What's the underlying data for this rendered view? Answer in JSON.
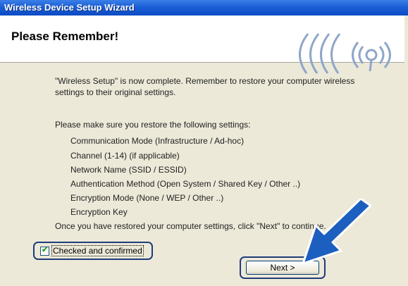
{
  "window": {
    "title": "Wireless Device Setup Wizard"
  },
  "header": {
    "title": "Please Remember!"
  },
  "content": {
    "intro_line1": "\"Wireless Setup\" is now complete. Remember to restore your computer wireless",
    "intro_line2": "settings to their original settings.",
    "list_intro": "Please make sure you restore the following settings:",
    "settings": [
      "Communication Mode (Infrastructure / Ad-hoc)",
      "Channel (1-14) (if applicable)",
      "Network Name (SSID / ESSID)",
      "Authentication Method (Open System / Shared Key / Other ..)",
      "Encryption Mode (None / WEP / Other ..)",
      "Encryption Key"
    ],
    "outro": "Once you have restored your computer settings, click \"Next\" to continue."
  },
  "controls": {
    "checkbox_label": "Checked and confirmed",
    "checkbox_checked": true,
    "next_label": "Next >"
  },
  "colors": {
    "title_bar": "#0b4bc4",
    "annotation_arrow": "#1c5fbf",
    "banner_blue": "#8ea6c9"
  }
}
